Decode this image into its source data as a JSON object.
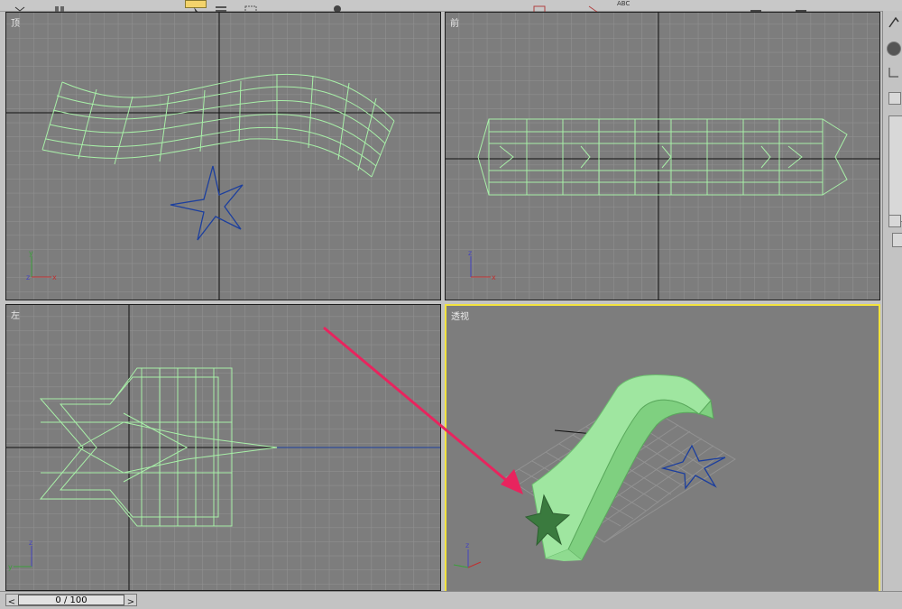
{
  "toolbar": {
    "abc_label": "ABC"
  },
  "viewports": {
    "top": {
      "label": "顶"
    },
    "front": {
      "label": "前"
    },
    "left": {
      "label": "左"
    },
    "perspective": {
      "label": "透视"
    }
  },
  "axes": {
    "x": "x",
    "y": "y",
    "z": "z"
  },
  "timeline": {
    "frame_display": "0 / 100",
    "prev_icon": "<",
    "next_icon": ">"
  },
  "colors": {
    "viewport_bg": "#7d7d7d",
    "grid": "#8e8e8e",
    "wire": "#a8f0a8",
    "spline": "#1c3f9e",
    "active_border": "#f3e33d",
    "annotation_arrow": "#e8245e"
  }
}
